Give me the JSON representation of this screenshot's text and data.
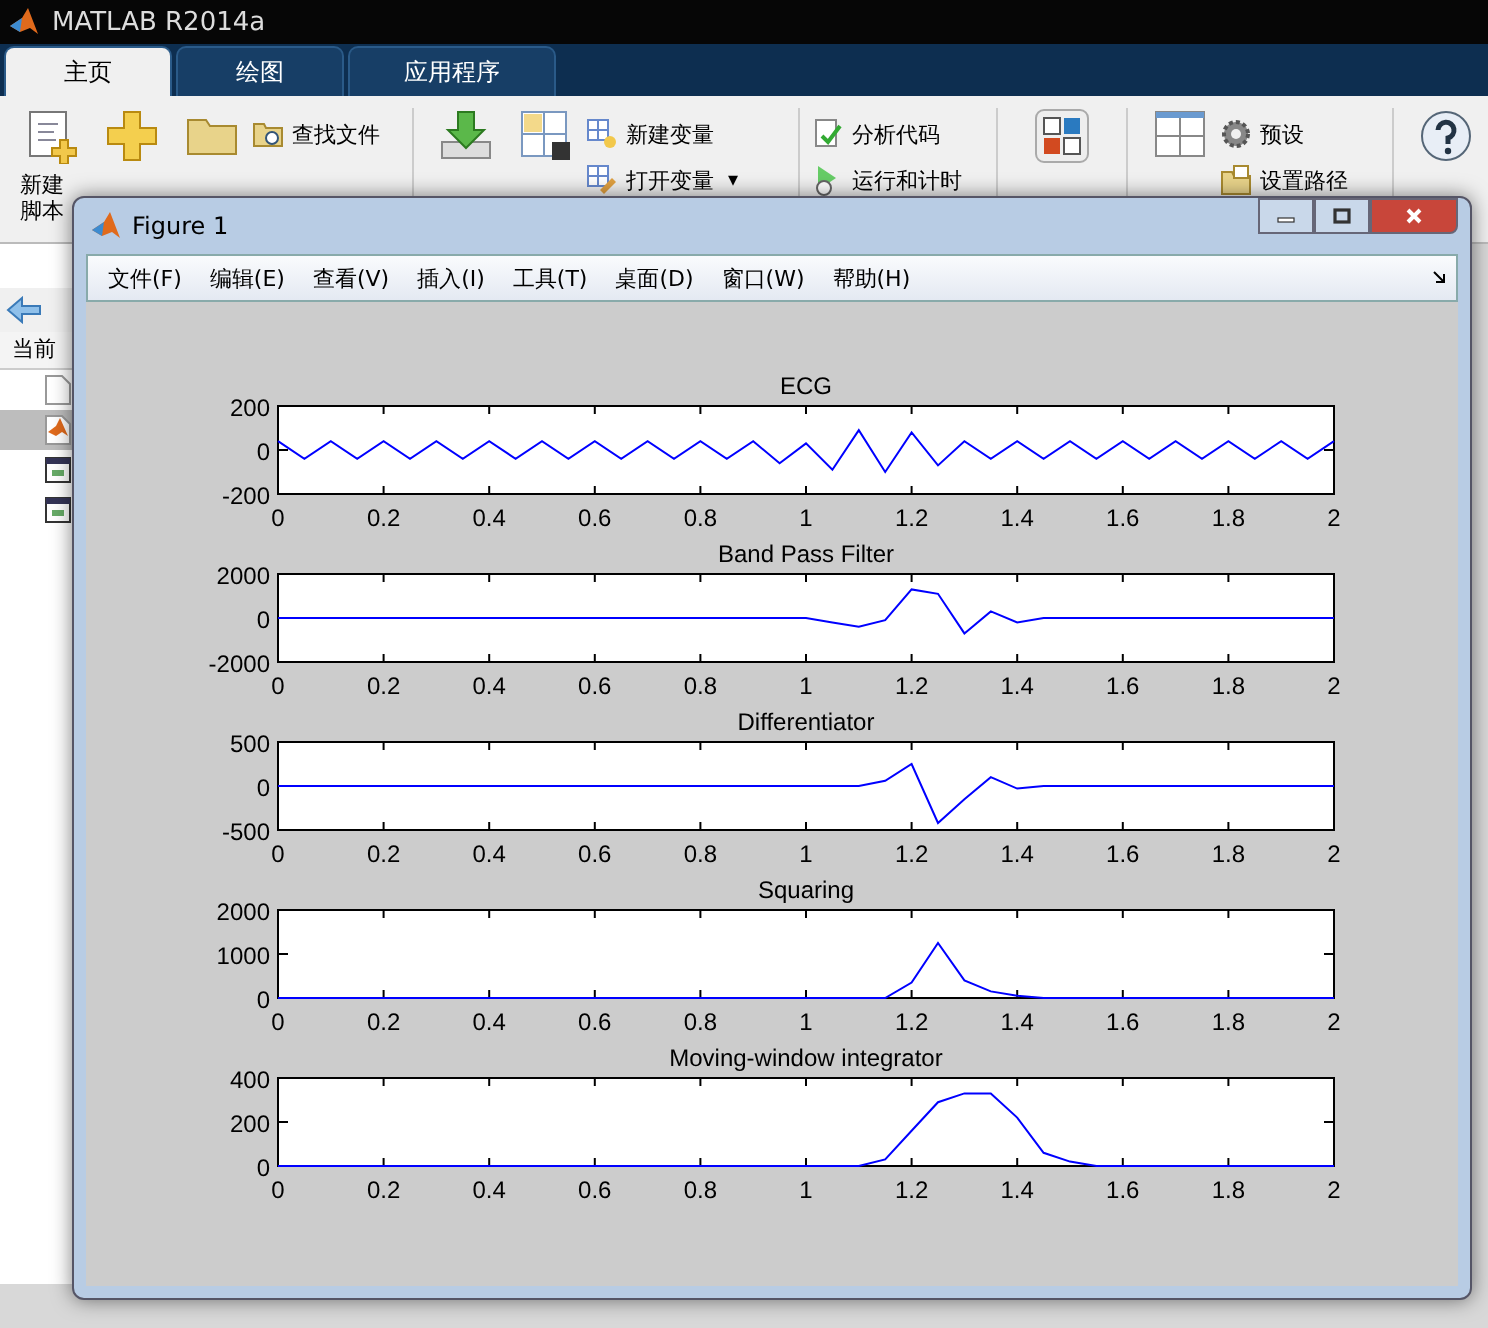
{
  "main_window": {
    "title": "MATLAB R2014a"
  },
  "tabs": [
    {
      "label": "主页",
      "selected": true
    },
    {
      "label": "绘图",
      "selected": false
    },
    {
      "label": "应用程序",
      "selected": false
    }
  ],
  "ribbon": {
    "new_script": [
      "新建",
      "脚本"
    ],
    "small_items": [
      {
        "kind": "find",
        "label": "查找文件"
      },
      {
        "kind": "new_var",
        "label": "新建变量"
      },
      {
        "kind": "open_var",
        "label": "打开变量",
        "caret": "▾"
      },
      {
        "kind": "analyze",
        "label": "分析代码"
      },
      {
        "kind": "run_time",
        "label": "运行和计时"
      },
      {
        "kind": "prefs",
        "label": "预设"
      },
      {
        "kind": "path",
        "label": "设置路径"
      }
    ]
  },
  "current_folder": {
    "header": "当前",
    "files": [
      {
        "kind": "blank",
        "selected": false
      },
      {
        "kind": "matlab",
        "selected": true
      },
      {
        "kind": "figure",
        "selected": false
      },
      {
        "kind": "figure",
        "selected": false
      }
    ]
  },
  "figure": {
    "title": "Figure 1",
    "menu": [
      "文件(F)",
      "编辑(E)",
      "查看(V)",
      "插入(I)",
      "工具(T)",
      "桌面(D)",
      "窗口(W)",
      "帮助(H)"
    ],
    "plots": [
      {
        "chart_data": {
          "type": "line",
          "title": "ECG",
          "xlim": [
            0,
            2
          ],
          "ylim": [
            -200,
            200
          ],
          "xticks": [
            0,
            0.2,
            0.4,
            0.6,
            0.8,
            1,
            1.2,
            1.4,
            1.6,
            1.8,
            2
          ],
          "yticks": [
            -200,
            0,
            200
          ],
          "x": [
            0,
            0.05,
            0.1,
            0.15,
            0.2,
            0.25,
            0.3,
            0.35,
            0.4,
            0.45,
            0.5,
            0.55,
            0.6,
            0.65,
            0.7,
            0.75,
            0.8,
            0.85,
            0.9,
            0.95,
            1,
            1.05,
            1.1,
            1.15,
            1.2,
            1.25,
            1.3,
            1.35,
            1.4,
            1.45,
            1.5,
            1.55,
            1.6,
            1.65,
            1.7,
            1.75,
            1.8,
            1.85,
            1.9,
            1.95,
            2
          ],
          "series": [
            {
              "color": "#0000ff",
              "values": [
                40,
                -40,
                40,
                -40,
                40,
                -40,
                40,
                -40,
                40,
                -40,
                40,
                -40,
                40,
                -40,
                40,
                -40,
                40,
                -40,
                40,
                -60,
                30,
                -90,
                90,
                -100,
                80,
                -70,
                40,
                -40,
                40,
                -40,
                40,
                -40,
                40,
                -40,
                40,
                -40,
                40,
                -40,
                40,
                -40,
                40
              ]
            }
          ]
        }
      },
      {
        "chart_data": {
          "type": "line",
          "title": "Band Pass Filter",
          "xlim": [
            0,
            2
          ],
          "ylim": [
            -2000,
            2000
          ],
          "xticks": [
            0,
            0.2,
            0.4,
            0.6,
            0.8,
            1,
            1.2,
            1.4,
            1.6,
            1.8,
            2
          ],
          "yticks": [
            -2000,
            0,
            2000
          ],
          "x": [
            0,
            0.05,
            0.1,
            0.15,
            0.2,
            0.25,
            0.3,
            0.35,
            0.4,
            0.45,
            0.5,
            0.55,
            0.6,
            0.65,
            0.7,
            0.75,
            0.8,
            0.85,
            0.9,
            0.95,
            1,
            1.05,
            1.1,
            1.15,
            1.2,
            1.25,
            1.3,
            1.35,
            1.4,
            1.45,
            1.5,
            1.55,
            1.6,
            1.65,
            1.7,
            1.75,
            1.8,
            1.85,
            1.9,
            1.95,
            2
          ],
          "series": [
            {
              "color": "#0000ff",
              "values": [
                0,
                0,
                0,
                0,
                0,
                0,
                0,
                0,
                0,
                0,
                0,
                0,
                0,
                0,
                0,
                0,
                0,
                0,
                0,
                0,
                0,
                -200,
                -400,
                -100,
                1300,
                1100,
                -700,
                300,
                -200,
                0,
                0,
                0,
                0,
                0,
                0,
                0,
                0,
                0,
                0,
                0,
                0
              ]
            }
          ]
        }
      },
      {
        "chart_data": {
          "type": "line",
          "title": "Differentiator",
          "xlim": [
            0,
            2
          ],
          "ylim": [
            -500,
            500
          ],
          "xticks": [
            0,
            0.2,
            0.4,
            0.6,
            0.8,
            1,
            1.2,
            1.4,
            1.6,
            1.8,
            2
          ],
          "yticks": [
            -500,
            0,
            500
          ],
          "x": [
            0,
            0.05,
            0.1,
            0.15,
            0.2,
            0.25,
            0.3,
            0.35,
            0.4,
            0.45,
            0.5,
            0.55,
            0.6,
            0.65,
            0.7,
            0.75,
            0.8,
            0.85,
            0.9,
            0.95,
            1,
            1.05,
            1.1,
            1.15,
            1.2,
            1.25,
            1.3,
            1.35,
            1.4,
            1.45,
            1.5,
            1.55,
            1.6,
            1.65,
            1.7,
            1.75,
            1.8,
            1.85,
            1.9,
            1.95,
            2
          ],
          "series": [
            {
              "color": "#0000ff",
              "values": [
                0,
                0,
                0,
                0,
                0,
                0,
                0,
                0,
                0,
                0,
                0,
                0,
                0,
                0,
                0,
                0,
                0,
                0,
                0,
                0,
                0,
                0,
                0,
                60,
                250,
                -420,
                -150,
                100,
                -30,
                0,
                0,
                0,
                0,
                0,
                0,
                0,
                0,
                0,
                0,
                0,
                0
              ]
            }
          ]
        }
      },
      {
        "chart_data": {
          "type": "line",
          "title": "Squaring",
          "xlim": [
            0,
            2
          ],
          "ylim": [
            0,
            2000
          ],
          "xticks": [
            0,
            0.2,
            0.4,
            0.6,
            0.8,
            1,
            1.2,
            1.4,
            1.6,
            1.8,
            2
          ],
          "yticks": [
            0,
            1000,
            2000
          ],
          "x": [
            0,
            0.05,
            0.1,
            0.15,
            0.2,
            0.25,
            0.3,
            0.35,
            0.4,
            0.45,
            0.5,
            0.55,
            0.6,
            0.65,
            0.7,
            0.75,
            0.8,
            0.85,
            0.9,
            0.95,
            1,
            1.05,
            1.1,
            1.15,
            1.2,
            1.25,
            1.3,
            1.35,
            1.4,
            1.45,
            1.5,
            1.55,
            1.6,
            1.65,
            1.7,
            1.75,
            1.8,
            1.85,
            1.9,
            1.95,
            2
          ],
          "series": [
            {
              "color": "#0000ff",
              "values": [
                0,
                0,
                0,
                0,
                0,
                0,
                0,
                0,
                0,
                0,
                0,
                0,
                0,
                0,
                0,
                0,
                0,
                0,
                0,
                0,
                0,
                0,
                0,
                0,
                350,
                1250,
                400,
                150,
                50,
                0,
                0,
                0,
                0,
                0,
                0,
                0,
                0,
                0,
                0,
                0,
                0
              ]
            }
          ]
        }
      },
      {
        "chart_data": {
          "type": "line",
          "title": "Moving-window integrator",
          "xlim": [
            0,
            2
          ],
          "ylim": [
            0,
            400
          ],
          "xticks": [
            0,
            0.2,
            0.4,
            0.6,
            0.8,
            1,
            1.2,
            1.4,
            1.6,
            1.8,
            2
          ],
          "yticks": [
            0,
            200,
            400
          ],
          "x": [
            0,
            0.05,
            0.1,
            0.15,
            0.2,
            0.25,
            0.3,
            0.35,
            0.4,
            0.45,
            0.5,
            0.55,
            0.6,
            0.65,
            0.7,
            0.75,
            0.8,
            0.85,
            0.9,
            0.95,
            1,
            1.05,
            1.1,
            1.15,
            1.2,
            1.25,
            1.3,
            1.35,
            1.4,
            1.45,
            1.5,
            1.55,
            1.6,
            1.65,
            1.7,
            1.75,
            1.8,
            1.85,
            1.9,
            1.95,
            2
          ],
          "series": [
            {
              "color": "#0000ff",
              "values": [
                0,
                0,
                0,
                0,
                0,
                0,
                0,
                0,
                0,
                0,
                0,
                0,
                0,
                0,
                0,
                0,
                0,
                0,
                0,
                0,
                0,
                0,
                0,
                30,
                160,
                290,
                330,
                330,
                220,
                60,
                20,
                0,
                0,
                0,
                0,
                0,
                0,
                0,
                0,
                0,
                0
              ]
            }
          ]
        }
      }
    ]
  }
}
